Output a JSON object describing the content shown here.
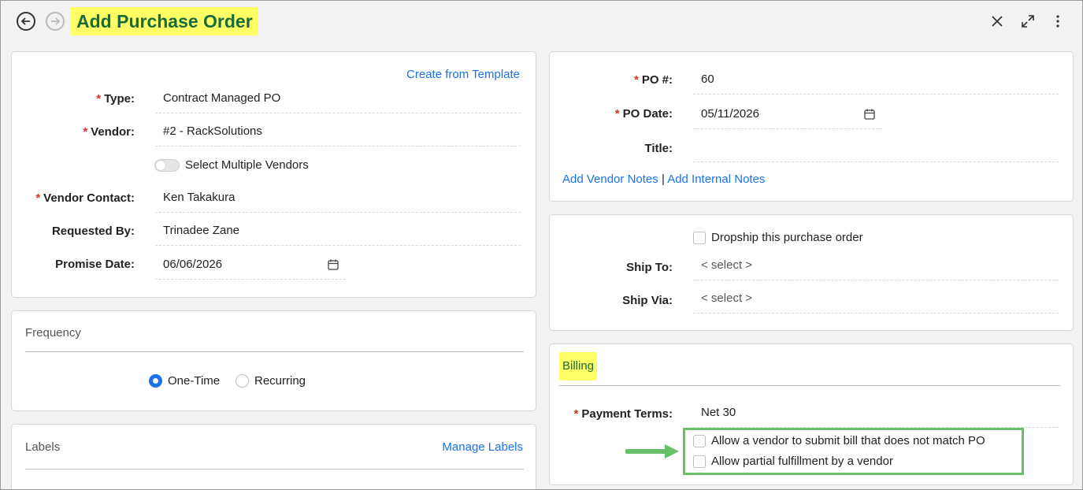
{
  "header": {
    "title": "Add Purchase Order",
    "back_icon": "back-circle-icon",
    "forward_icon": "forward-circle-icon",
    "close_icon": "close-icon",
    "expand_icon": "expand-icon",
    "more_icon": "more-vertical-icon"
  },
  "order_details": {
    "template_link": "Create from Template",
    "type": {
      "label": "Type:",
      "value": "Contract Managed PO"
    },
    "vendor": {
      "label": "Vendor:",
      "value": "#2 - RackSolutions"
    },
    "multiple_vendors_label": "Select Multiple Vendors",
    "vendor_contact": {
      "label": "Vendor Contact:",
      "value": "Ken Takakura"
    },
    "requested_by": {
      "label": "Requested By:",
      "value": "Trinadee Zane"
    },
    "promise_date": {
      "label": "Promise Date:",
      "value": "06/06/2026"
    }
  },
  "frequency": {
    "title": "Frequency",
    "options": [
      "One-Time",
      "Recurring"
    ],
    "selected": "One-Time"
  },
  "labels": {
    "title": "Labels",
    "manage_link": "Manage Labels"
  },
  "po_info": {
    "po_number": {
      "label": "PO #:",
      "value": "60"
    },
    "po_date": {
      "label": "PO Date:",
      "value": "05/11/2026"
    },
    "title": {
      "label": "Title:",
      "value": ""
    },
    "vendor_notes_link": "Add Vendor Notes",
    "separator": "|",
    "internal_notes_link": "Add Internal Notes"
  },
  "shipping": {
    "dropship_label": "Dropship this purchase order",
    "ship_to": {
      "label": "Ship To:",
      "value": "< select >"
    },
    "ship_via": {
      "label": "Ship Via:",
      "value": "< select >"
    }
  },
  "billing": {
    "title": "Billing",
    "payment_terms": {
      "label": "Payment Terms:",
      "value": "Net 30"
    },
    "allow_mismatch_label": "Allow a vendor to submit bill that does not match PO",
    "allow_partial_label": "Allow partial fulfillment by a vendor"
  },
  "colors": {
    "accent": "#1a73e8",
    "highlight": "#ffff66",
    "title_text": "#1a6b3c",
    "required": "#d9302c",
    "annotation": "#6abf69"
  }
}
